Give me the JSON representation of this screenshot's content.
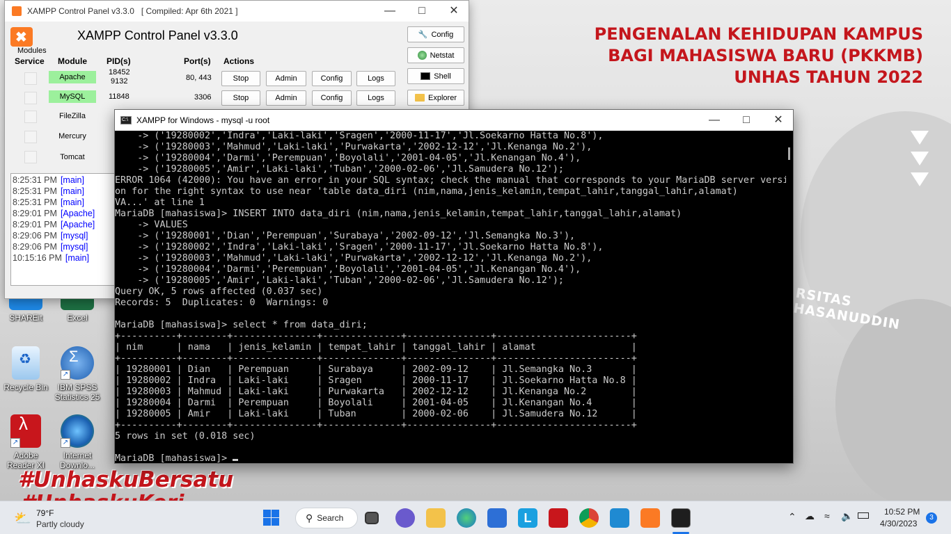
{
  "wallpaper": {
    "title_lines": [
      "PENGENALAN KEHIDUPAN KAMPUS",
      "BAGI MAHASISWA BARU (PKKMB)",
      "UNHAS TAHUN 2022"
    ],
    "university_text": "RSITAS HASANUDDIN",
    "hashtag": "#UnhaskuBersatu",
    "hashtag2": "#UnhaskuKeri",
    "accent_color": "#c4161c"
  },
  "desktop_icons": [
    {
      "label": "SHAREit",
      "icon": "shareit-icon"
    },
    {
      "label": "Excel",
      "icon": "excel-icon"
    },
    {
      "label": "Recycle Bin",
      "icon": "recycle-bin-icon"
    },
    {
      "label": "IBM SPSS Statistics 25",
      "icon": "spss-icon"
    },
    {
      "label": "Adobe Reader XI",
      "icon": "adobe-reader-icon"
    },
    {
      "label": "Internet Downlo...",
      "icon": "idm-icon"
    }
  ],
  "xampp": {
    "window_title": "XAMPP Control Panel v3.3.0   [ Compiled: Apr 6th 2021 ]",
    "heading": "XAMPP Control Panel v3.3.0",
    "modules_label": "Modules",
    "headers": {
      "service": "Service",
      "module": "Module",
      "pid": "PID(s)",
      "ports": "Port(s)",
      "actions": "Actions"
    },
    "modules": [
      {
        "name": "Apache",
        "pid": "18452\n9132",
        "ports": "80, 443",
        "running": true,
        "stop": "Stop",
        "admin": "Admin",
        "config": "Config",
        "logs": "Logs"
      },
      {
        "name": "MySQL",
        "pid": "11848",
        "ports": "3306",
        "running": true,
        "stop": "Stop",
        "admin": "Admin",
        "config": "Config",
        "logs": "Logs"
      },
      {
        "name": "FileZilla",
        "running": false
      },
      {
        "name": "Mercury",
        "running": false
      },
      {
        "name": "Tomcat",
        "running": false
      }
    ],
    "side_buttons": {
      "config": "Config",
      "netstat": "Netstat",
      "shell": "Shell",
      "explorer": "Explorer"
    },
    "log": [
      {
        "time": "8:25:31 PM",
        "module": "[main]"
      },
      {
        "time": "8:25:31 PM",
        "module": "[main]"
      },
      {
        "time": "8:25:31 PM",
        "module": "[main]"
      },
      {
        "time": "8:29:01 PM",
        "module": "[Apache]"
      },
      {
        "time": "8:29:01 PM",
        "module": "[Apache]"
      },
      {
        "time": "8:29:06 PM",
        "module": "[mysql]"
      },
      {
        "time": "8:29:06 PM",
        "module": "[mysql]"
      },
      {
        "time": "10:15:16 PM",
        "module": "[main]"
      }
    ],
    "running_color": "#9cf09c"
  },
  "console": {
    "window_title": "XAMPP for Windows - mysql  -u root",
    "lines": [
      "    -> ('19280002','Indra','Laki-laki','Sragen','2000-11-17','Jl.Soekarno Hatta No.8'),",
      "    -> ('19280003','Mahmud','Laki-laki','Purwakarta','2002-12-12','Jl.Kenanga No.2'),",
      "    -> ('19280004','Darmi','Perempuan','Boyolali','2001-04-05','Jl.Kenangan No.4'),",
      "    -> ('19280005','Amir','Laki-laki','Tuban','2000-02-06','Jl.Samudera No.12');",
      "ERROR 1064 (42000): You have an error in your SQL syntax; check the manual that corresponds to your MariaDB server versi",
      "on for the right syntax to use near 'table data_diri (nim,nama,jenis_kelamin,tempat_lahir,tanggal_lahir,alamat)",
      "VA...' at line 1",
      "MariaDB [mahasiswa]> INSERT INTO data_diri (nim,nama,jenis_kelamin,tempat_lahir,tanggal_lahir,alamat)",
      "    -> VALUES",
      "    -> ('19280001','Dian','Perempuan','Surabaya','2002-09-12','Jl.Semangka No.3'),",
      "    -> ('19280002','Indra','Laki-laki','Sragen','2000-11-17','Jl.Soekarno Hatta No.8'),",
      "    -> ('19280003','Mahmud','Laki-laki','Purwakarta','2002-12-12','Jl.Kenanga No.2'),",
      "    -> ('19280004','Darmi','Perempuan','Boyolali','2001-04-05','Jl.Kenangan No.4'),",
      "    -> ('19280005','Amir','Laki-laki','Tuban','2000-02-06','Jl.Samudera No.12');",
      "Query OK, 5 rows affected (0.037 sec)",
      "Records: 5  Duplicates: 0  Warnings: 0",
      "",
      "MariaDB [mahasiswa]> select * from data_diri;",
      "+----------+--------+---------------+--------------+---------------+------------------------+",
      "| nim      | nama   | jenis_kelamin | tempat_lahir | tanggal_lahir | alamat                 |",
      "+----------+--------+---------------+--------------+---------------+------------------------+",
      "| 19280001 | Dian   | Perempuan     | Surabaya     | 2002-09-12    | Jl.Semangka No.3       |",
      "| 19280002 | Indra  | Laki-laki     | Sragen       | 2000-11-17    | Jl.Soekarno Hatta No.8 |",
      "| 19280003 | Mahmud | Laki-laki     | Purwakarta   | 2002-12-12    | Jl.Kenanga No.2        |",
      "| 19280004 | Darmi  | Perempuan     | Boyolali     | 2001-04-05    | Jl.Kenangan No.4       |",
      "| 19280005 | Amir   | Laki-laki     | Tuban        | 2000-02-06    | Jl.Samudera No.12      |",
      "+----------+--------+---------------+--------------+---------------+------------------------+",
      "5 rows in set (0.018 sec)",
      ""
    ],
    "prompt": "MariaDB [mahasiswa]> "
  },
  "taskbar": {
    "weather_temp": "79°F",
    "weather_desc": "Partly cloudy",
    "search_label": "Search",
    "time": "10:52 PM",
    "date": "4/30/2023",
    "notification_count": "3",
    "apps": [
      "start-icon",
      "search-icon",
      "task-view-icon",
      "chat-icon",
      "file-explorer-icon",
      "edge-icon",
      "store-icon",
      "launcher-icon",
      "mcafee-icon",
      "chrome-icon",
      "vscode-icon",
      "xampp-icon",
      "terminal-icon"
    ]
  }
}
